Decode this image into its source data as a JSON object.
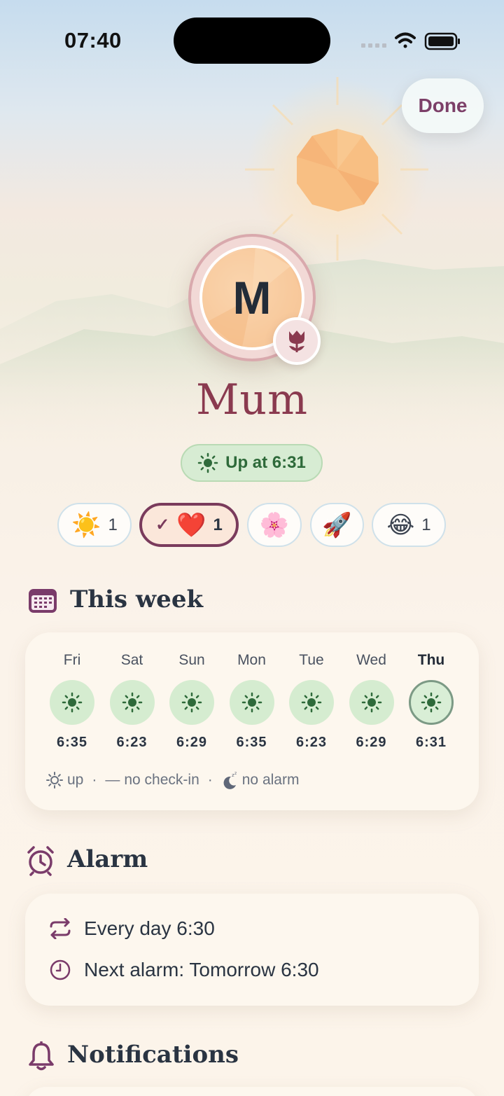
{
  "status_bar": {
    "time": "07:40"
  },
  "header": {
    "done_label": "Done"
  },
  "profile": {
    "initial": "M",
    "name": "Mum",
    "status": "Up at 6:31",
    "badge_icon": "tulip-icon"
  },
  "reactions": [
    {
      "emoji": "☀️",
      "icon": "sun-emoji",
      "count": "1",
      "selected": false,
      "check": ""
    },
    {
      "emoji": "❤️",
      "icon": "heart-emoji",
      "count": "1",
      "selected": true,
      "check": "✓"
    },
    {
      "emoji": "🌸",
      "icon": "blossom-emoji",
      "count": "",
      "selected": false,
      "check": ""
    },
    {
      "emoji": "🚀",
      "icon": "rocket-emoji",
      "count": "",
      "selected": false,
      "check": ""
    },
    {
      "emoji": "😂",
      "icon": "laughing-emoji",
      "count": "1",
      "selected": false,
      "check": ""
    }
  ],
  "week": {
    "title": "This week",
    "days": [
      {
        "day": "Fri",
        "time": "6:35",
        "today": false
      },
      {
        "day": "Sat",
        "time": "6:23",
        "today": false
      },
      {
        "day": "Sun",
        "time": "6:29",
        "today": false
      },
      {
        "day": "Mon",
        "time": "6:35",
        "today": false
      },
      {
        "day": "Tue",
        "time": "6:23",
        "today": false
      },
      {
        "day": "Wed",
        "time": "6:29",
        "today": false
      },
      {
        "day": "Thu",
        "time": "6:31",
        "today": true
      }
    ],
    "legend": {
      "up": "up",
      "no_checkin": "no check-in",
      "no_alarm": "no alarm",
      "separator": "·",
      "dash": "—"
    }
  },
  "alarm": {
    "title": "Alarm",
    "schedule": "Every day 6:30",
    "next": "Next alarm: Tomorrow 6:30"
  },
  "notifications": {
    "title": "Notifications"
  },
  "colors": {
    "accent": "#7c3f68",
    "name": "#8a3a4f",
    "green": "#2e6a3a",
    "green_bg": "#d5ecd0"
  }
}
